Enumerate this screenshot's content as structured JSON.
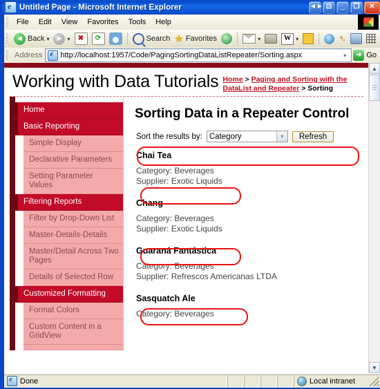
{
  "window": {
    "title": "Untitled Page - Microsoft Internet Explorer",
    "icon": "ie-document-icon",
    "controls": {
      "restore_group_label": "◄►",
      "restore_small_label": "⊡",
      "minimize_label": "_",
      "maximize_label": "❐",
      "close_label": "✕"
    }
  },
  "menubar": {
    "items": [
      {
        "label": "File"
      },
      {
        "label": "Edit"
      },
      {
        "label": "View"
      },
      {
        "label": "Favorites"
      },
      {
        "label": "Tools"
      },
      {
        "label": "Help"
      }
    ]
  },
  "toolbar": {
    "back_label": "Back",
    "back_caret": "▾",
    "forward_caret": "▾",
    "stop_glyph": "✖",
    "refresh_glyph": "⟳",
    "home_glyph": "⌂",
    "search_label": "Search",
    "favorites_label": "Favorites",
    "media_label": "",
    "mail_caret": "▾",
    "word_glyph": "W",
    "word_caret": "▾",
    "notes_label": "",
    "messenger_label": "",
    "bird_glyph": "~",
    "research_label": "",
    "grid_label": ""
  },
  "address_bar": {
    "label": "Address",
    "url": "http://localhost:1957/Code/PagingSortingDataListRepeater/Sorting.aspx",
    "dropdown_glyph": "▾",
    "go_label": "Go",
    "go_glyph": "➜"
  },
  "page": {
    "site_title": "Working with Data Tutorials",
    "breadcrumb": {
      "home": "Home",
      "sep1": " > ",
      "parent": "Paging and Sorting with the DataList and Repeater",
      "sep2": " > ",
      "current": "Sorting"
    },
    "heading": "Sorting Data in a Repeater Control",
    "sort_label": "Sort the results by:",
    "sort_value": "Category",
    "sort_caret": "▾",
    "refresh_label": "Refresh",
    "products": [
      {
        "name": "Chai Tea",
        "category": "Category: Beverages",
        "supplier": "Supplier: Exotic Liquids"
      },
      {
        "name": "Chang",
        "category": "Category: Beverages",
        "supplier": "Supplier: Exotic Liquids"
      },
      {
        "name": "Guaraná Fantástica",
        "category": "Category: Beverages",
        "supplier": "Supplier: Refrescos Americanas LTDA"
      },
      {
        "name": "Sasquatch Ale",
        "category": "Category: Beverages",
        "supplier": ""
      }
    ]
  },
  "sidebar": {
    "items": [
      {
        "label": "Home",
        "type": "section"
      },
      {
        "label": "Basic Reporting",
        "type": "section"
      },
      {
        "label": "Simple Display",
        "type": "sub"
      },
      {
        "label": "Declarative Parameters",
        "type": "sub"
      },
      {
        "label": "Setting Parameter Values",
        "type": "sub"
      },
      {
        "label": "Filtering Reports",
        "type": "section"
      },
      {
        "label": "Filter by Drop-Down List",
        "type": "sub"
      },
      {
        "label": "Master-Details-Details",
        "type": "sub"
      },
      {
        "label": "Master/Detail Across Two Pages",
        "type": "sub"
      },
      {
        "label": "Details of Selected Row",
        "type": "sub"
      },
      {
        "label": "Customized Formatting",
        "type": "section"
      },
      {
        "label": "Format Colors",
        "type": "sub"
      },
      {
        "label": "Custom Content in a GridView",
        "type": "sub"
      },
      {
        "label": "",
        "type": "sub"
      }
    ]
  },
  "scrollbar": {
    "up_glyph": "▲",
    "down_glyph": "▼"
  },
  "statusbar": {
    "status": "Done",
    "zone": "Local intranet"
  },
  "colors": {
    "accent_dark_red": "#8b0b16",
    "section_red": "#c10b28",
    "sub_pink": "#f4aaab",
    "link_red": "#c01020",
    "annotation_red": "#ee1111",
    "title_blue": "#0a46c8"
  }
}
